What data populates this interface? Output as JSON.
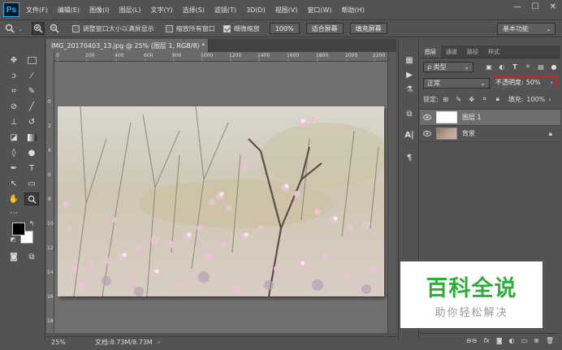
{
  "app": {
    "logo": "Ps"
  },
  "menu": [
    "文件(F)",
    "编辑(E)",
    "图像(I)",
    "图层(L)",
    "文字(Y)",
    "选择(S)",
    "滤镜(T)",
    "3D(D)",
    "视图(V)",
    "窗口(W)",
    "帮助(H)"
  ],
  "window_controls": {
    "minimize": "—",
    "maximize": "☐",
    "close": "✕"
  },
  "options": {
    "resize_windows_label": "调整窗口大小以满屏显示",
    "resize_windows_checked": false,
    "zoom_all_label": "缩放所有窗口",
    "zoom_all_checked": false,
    "scrubby_zoom_label": "细微缩放",
    "scrubby_zoom_checked": true,
    "zoom_value": "100%",
    "fit_screen": "适合屏幕",
    "fill_screen": "填充屏幕",
    "workspace": "基本功能"
  },
  "document": {
    "tab_title": "IMG_20170403_13.jpg @ 25% (图层 1, RGB/8) *",
    "tab_close": "×",
    "ruler_top": [
      "0",
      "200",
      "400",
      "600",
      "800",
      "1000",
      "1200",
      "1400",
      "1600",
      "1800",
      "2000",
      "2200"
    ],
    "ruler_left": [
      "0",
      "2",
      "4",
      "6",
      "8",
      "10",
      "12",
      "14",
      "16",
      "18"
    ],
    "zoom": "25%",
    "doc_info": "文档:8.73M/8.73M"
  },
  "layers_panel": {
    "tabs": [
      "图层",
      "通道",
      "路径",
      "样式"
    ],
    "kind_filter": "ρ 类型",
    "blend_mode": "正常",
    "opacity_label": "不透明度:",
    "opacity_value": "50%",
    "lock_label": "锁定:",
    "fill_label": "填充:",
    "fill_value": "100%",
    "layers": [
      {
        "name": "图层 1",
        "selected": true
      },
      {
        "name": "背景",
        "selected": false
      }
    ]
  },
  "watermark": {
    "title": "百科全说",
    "subtitle": "助你轻松解决"
  },
  "colors": {
    "ui_bg": "#535353",
    "watermark_green": "#2dad3a",
    "opacity_highlight": "#dd2222"
  }
}
